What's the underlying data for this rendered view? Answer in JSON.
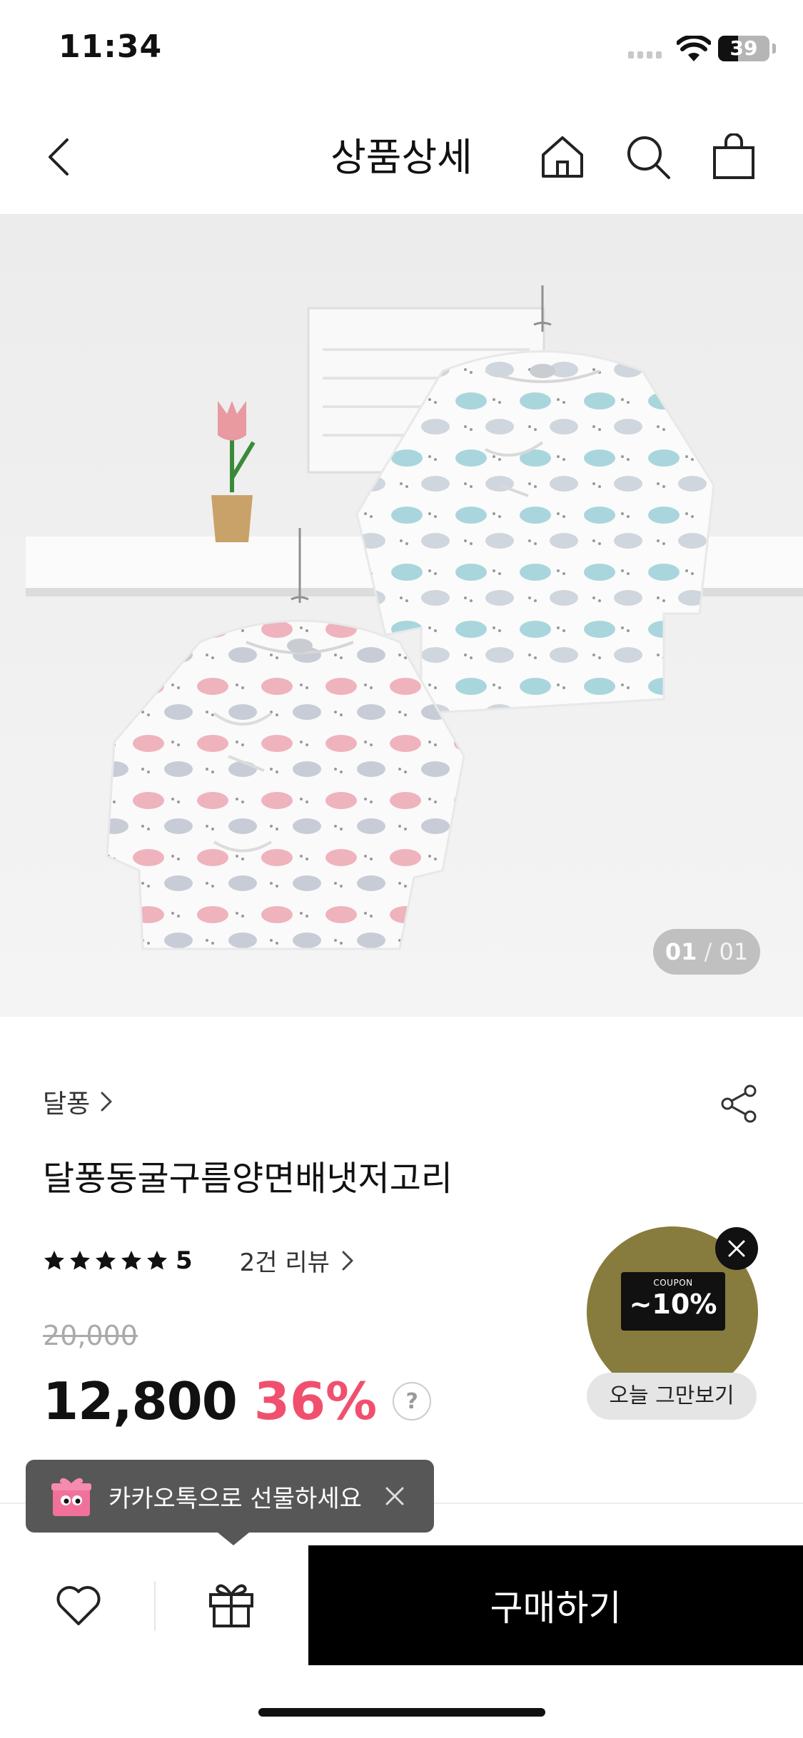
{
  "status": {
    "time": "11:34",
    "battery": "39",
    "battery_level": 0.39
  },
  "header": {
    "title": "상품상세",
    "icons": [
      "back-icon",
      "home-icon",
      "search-icon",
      "cart-icon"
    ]
  },
  "gallery": {
    "current": "01",
    "separator": "/",
    "total": "01"
  },
  "product": {
    "brand": "달퐁",
    "name": "달퐁동굴구름양면배냇저고리",
    "rating": "5",
    "rating_stars": 5,
    "review_link": "2건 리뷰",
    "original_price": "20,000",
    "sale_price": "12,800",
    "discount": "36%",
    "help": "?"
  },
  "coupon": {
    "label": "COUPON",
    "value": "~10%",
    "dismiss": "오늘 그만보기",
    "color": "#877c3d"
  },
  "toast": {
    "text": "카카오톡으로 선물하세요"
  },
  "bottom_bar": {
    "buy_label": "구매하기"
  },
  "colors": {
    "discount": "#f0506e",
    "buy_button": "#000000"
  }
}
